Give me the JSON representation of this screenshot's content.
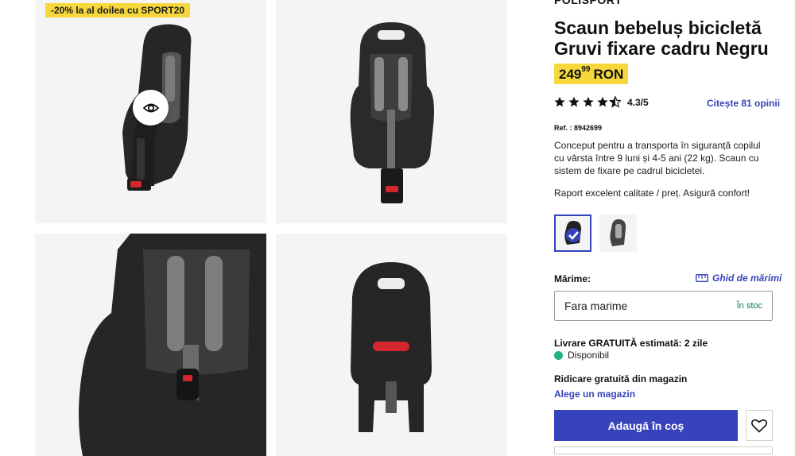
{
  "gallery": {
    "promo": "-20% la al doilea cu SPORT20",
    "images": [
      {
        "name": "seat-side-view"
      },
      {
        "name": "seat-front-view"
      },
      {
        "name": "seat-closeup-harness"
      },
      {
        "name": "seat-back-view"
      }
    ]
  },
  "product": {
    "brand": "POLISPORT",
    "title": "Scaun bebeluș bicicletă Gruvi fixare cadru Negru",
    "price_int": "249",
    "price_dec": "99",
    "currency": "RON",
    "rating": "4.3/5",
    "rating_value": 4.3,
    "rating_max": 5,
    "reviews": "Citește 81 opinii",
    "ref": "Ref. : 8942699",
    "description": "Conceput pentru a transporta în siguranță copilul cu vârsta între 9 luni și 4-5 ani (22 kg). Scaun cu sistem de fixare pe cadrul bicicletei.",
    "highlight": "Raport excelent calitate / preț. Asigură confort!"
  },
  "variants": [
    {
      "name": "Negru",
      "selected": true
    },
    {
      "name": "Gri",
      "selected": false
    }
  ],
  "size": {
    "label": "Mărime:",
    "guide": "Ghid de mărimi",
    "value": "Fara marime",
    "stock": "În stoc"
  },
  "delivery": {
    "text": "Livrare GRATUITĂ estimată: 2 zile",
    "status": "Disponibil",
    "pickup": "Ridicare gratuită din magazin",
    "store_link": "Alege un magazin"
  },
  "actions": {
    "add_to_cart": "Adaugă în coș"
  },
  "colors": {
    "accent": "#3643ba",
    "promo": "#f7d83c",
    "available": "#24b27c",
    "stock_text": "#0d7d4d"
  }
}
